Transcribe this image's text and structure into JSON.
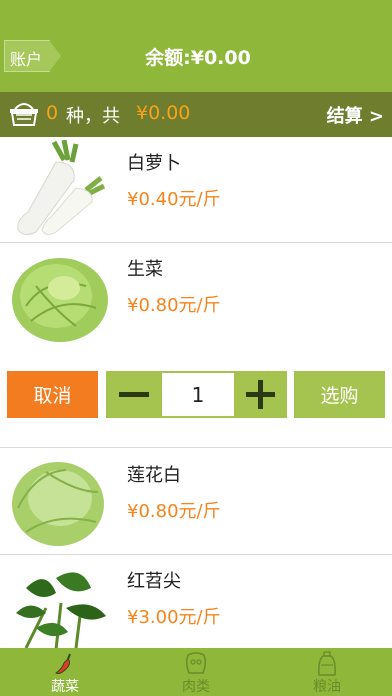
{
  "header": {
    "account_label": "账户",
    "balance_text": "余额:¥0.00"
  },
  "cart": {
    "count": "0",
    "mid_text": "种，共",
    "total": "¥0.00",
    "checkout_label": "结算 >"
  },
  "products": [
    {
      "name": "白萝卜",
      "price": "¥0.40元/斤"
    },
    {
      "name": "生菜",
      "price": "¥0.80元/斤"
    },
    {
      "name": "莲花白",
      "price": "¥0.80元/斤"
    },
    {
      "name": "红苕尖",
      "price": "¥3.00元/斤"
    }
  ],
  "actions": {
    "cancel_label": "取消",
    "quantity": "1",
    "select_label": "选购"
  },
  "tabs": [
    {
      "label": "蔬菜",
      "icon": "chili-pepper-icon",
      "active": true
    },
    {
      "label": "肉类",
      "icon": "meat-icon",
      "active": false
    },
    {
      "label": "粮油",
      "icon": "oil-bottle-icon",
      "active": false
    }
  ],
  "colors": {
    "header_green": "#8fb83a",
    "cart_bar": "#6f7d2e",
    "accent_orange": "#f7841b",
    "cancel_orange": "#f47c20",
    "button_green": "#a4c44f"
  }
}
